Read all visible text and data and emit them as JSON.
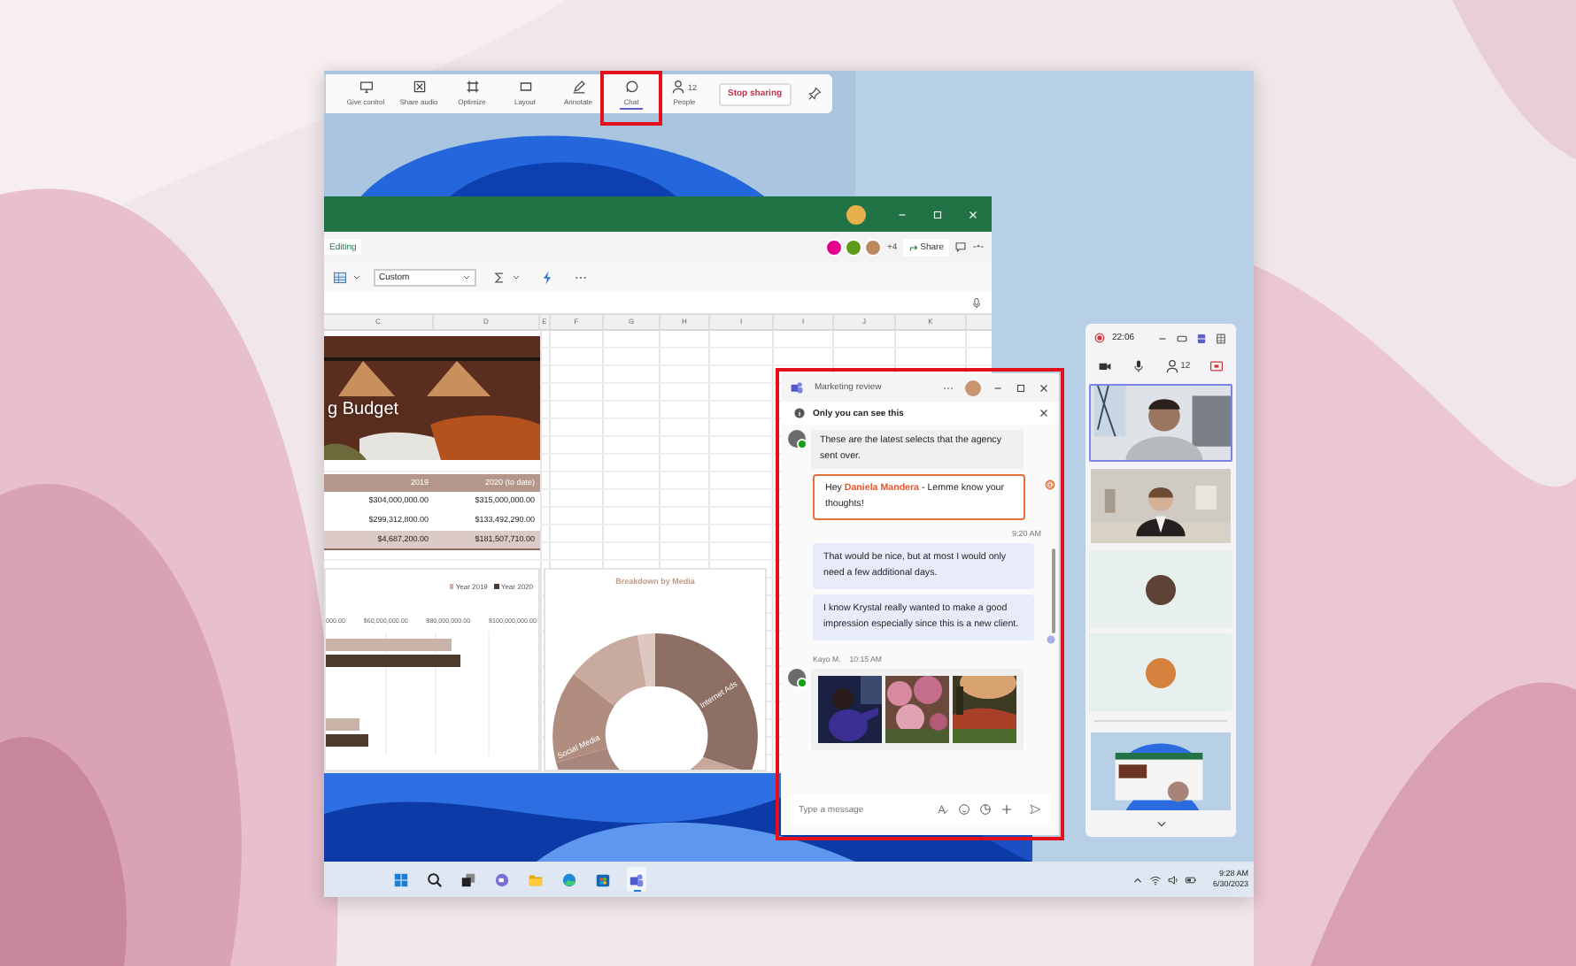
{
  "sharing_toolbar": {
    "buttons": [
      {
        "label": "Give control",
        "selected": false,
        "highlighted": false
      },
      {
        "label": "Share audio",
        "selected": false,
        "highlighted": false
      },
      {
        "label": "Optimize",
        "selected": false,
        "highlighted": false
      },
      {
        "label": "Layout",
        "selected": false,
        "highlighted": false
      },
      {
        "label": "Annotate",
        "selected": false,
        "highlighted": false
      },
      {
        "label": "Chat",
        "selected": true,
        "highlighted": true
      },
      {
        "label": "People",
        "count": "12",
        "selected": false,
        "highlighted": false
      }
    ],
    "stop_button": "Stop sharing"
  },
  "excel": {
    "editing": "Editing",
    "collaborators": [
      {
        "color": "#e3008c"
      },
      {
        "color": "#5c9a1b"
      },
      {
        "color": "#b98a62"
      }
    ],
    "extra_collaborators": "+4",
    "share": "Share",
    "number_format": "Custom",
    "columns": [
      "C",
      "D",
      "E",
      "F",
      "G",
      "H",
      "I",
      "I",
      "J",
      "K"
    ],
    "sheet_title": "g Budget",
    "table": {
      "columns": [
        "2019",
        "2020 (to date)"
      ],
      "rows": [
        [
          "$304,000,000.00",
          "$315,000,000.00"
        ],
        [
          "$299,312,800.00",
          "$133,492,290.00"
        ],
        [
          "$4,687,200.00",
          "$181,507,710.00"
        ]
      ]
    },
    "bar_chart": {
      "legend": [
        {
          "label": "Year 2019",
          "color": "#c9b3a8"
        },
        {
          "label": "Year 2020",
          "color": "#4e3b30"
        }
      ],
      "axis_labels": [
        "000.00",
        "$60,000,000.00",
        "$80,000,000.00",
        "$100,000,000.00"
      ]
    },
    "donut_chart": {
      "title": "Breakdown by Media",
      "labels": [
        "Internet Ads",
        "Social Media"
      ]
    }
  },
  "chat": {
    "title": "Marketing review",
    "notice": "Only you can see this",
    "highlighted": true,
    "messages": [
      {
        "kind": "incoming",
        "text": "These are the latest selects that the agency sent over."
      },
      {
        "kind": "mention",
        "text": "Hey **Daniela Mandera** - Lemme know your thoughts!"
      },
      {
        "kind": "timestamp",
        "text": "9:20 AM"
      },
      {
        "kind": "outgoing",
        "text": "That would be nice, but at most I would only need a few additional days.",
        "read": false
      },
      {
        "kind": "outgoing",
        "text": "I know Krystal really wanted to make a good impression especially since this is a new client.",
        "read": true
      },
      {
        "kind": "photos",
        "sender": "Kayo M.",
        "time": "10:15 AM"
      }
    ],
    "placeholder": "Type a message"
  },
  "call": {
    "timer": "22:06",
    "participants": "12",
    "tiles": [
      {
        "kind": "video",
        "selected": true
      },
      {
        "kind": "video",
        "selected": false
      },
      {
        "kind": "avatar",
        "selected": false
      },
      {
        "kind": "avatar",
        "selected": false
      },
      {
        "kind": "screen",
        "selected": false
      }
    ]
  },
  "taskbar": {
    "apps": [
      {
        "active": false
      },
      {
        "active": false
      },
      {
        "active": false
      },
      {
        "active": false
      },
      {
        "active": false
      },
      {
        "active": false
      },
      {
        "active": false
      },
      {
        "active": true
      }
    ],
    "time": "9:28 AM",
    "date": "6/30/2023"
  }
}
